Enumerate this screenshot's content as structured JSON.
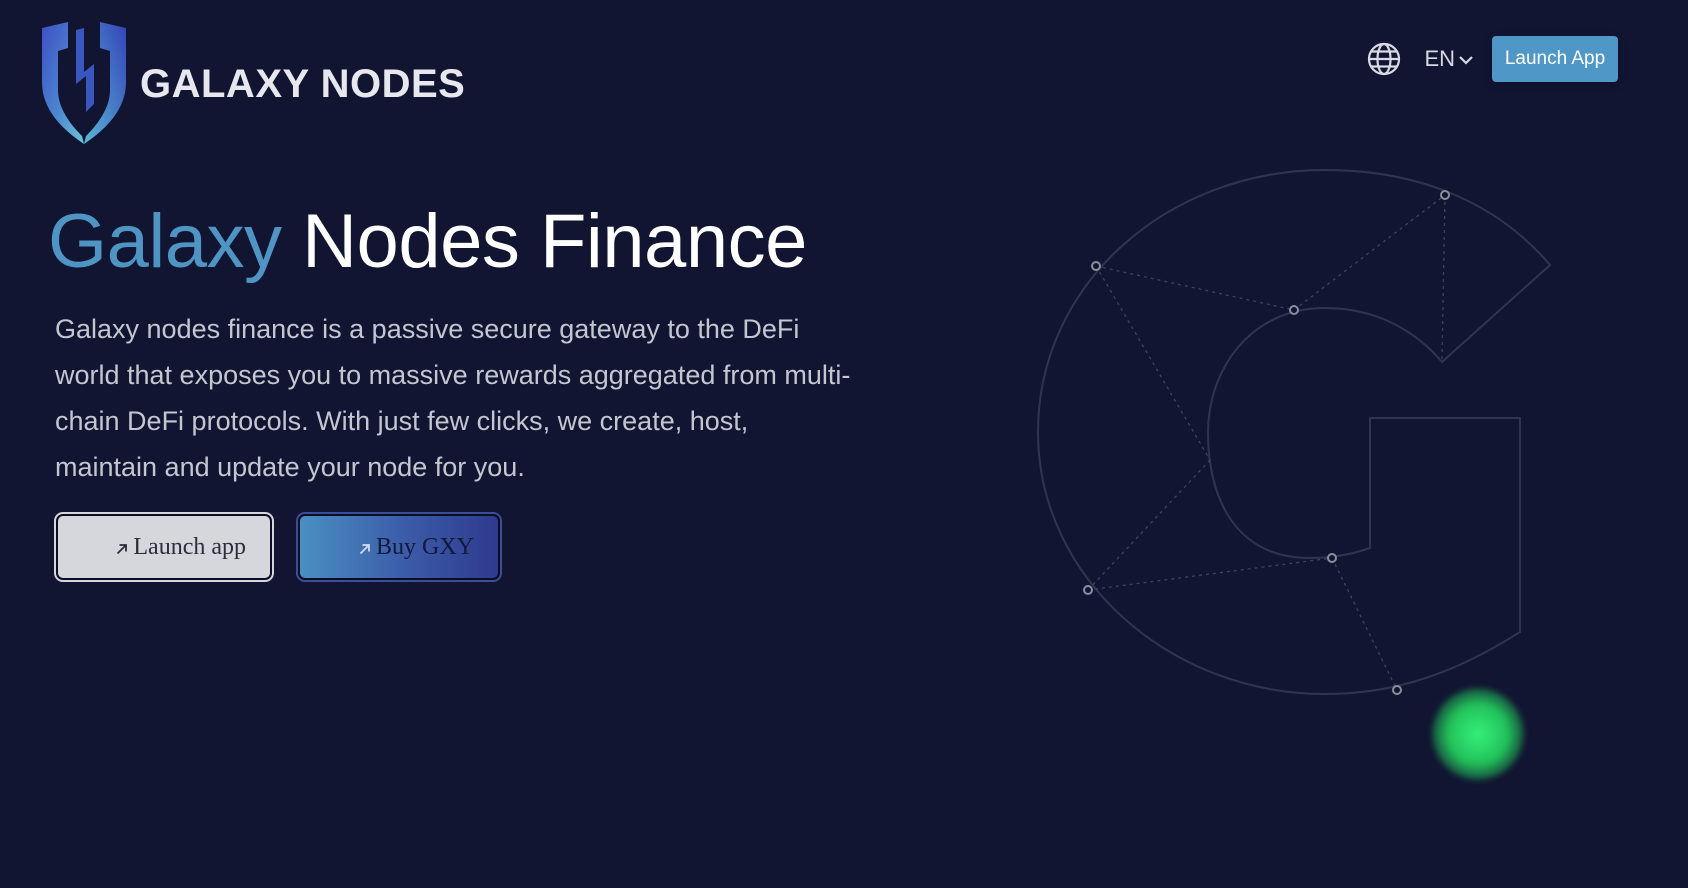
{
  "header": {
    "brand_name": "GALAXY NODES",
    "language": "EN",
    "launch_button": "Launch App"
  },
  "hero": {
    "title_accent": "Galaxy",
    "title_rest": "Nodes Finance",
    "description": "Galaxy nodes finance is a passive secure gateway to the DeFi world that exposes you to massive rewards aggregated from multi-chain DeFi protocols. With just few clicks, we create, host, maintain and update your node for you.",
    "launch_app_label": "Launch app",
    "buy_label": "Buy GXY"
  },
  "icons": {
    "logo": "shield-logo-icon",
    "language": "globe-icon",
    "dropdown": "chevron-down-icon",
    "button_arrow": "arrow-up-right-icon"
  },
  "colors": {
    "background": "#111532",
    "accent": "#4f95c3",
    "launch_button": "#4e97c6",
    "glow": "#2bd968"
  }
}
